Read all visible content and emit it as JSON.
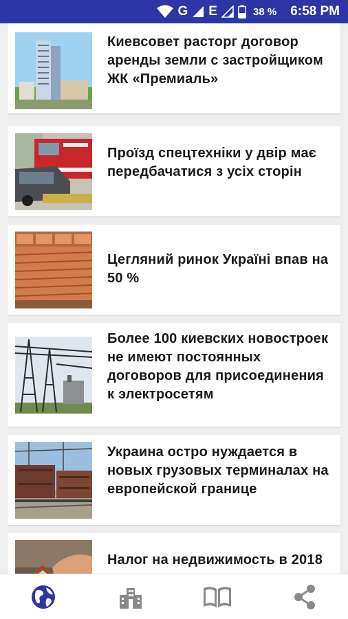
{
  "status_bar": {
    "network_label_1": "G",
    "network_label_2": "E",
    "battery_percent": "38 %",
    "time": "6:58 PM",
    "icons": [
      "wifi-icon",
      "signal-icon",
      "signal-icon",
      "battery-icon"
    ]
  },
  "articles": [
    {
      "title": "Киевсовет расторг договор аренды земли с застройщиком ЖК «Премиаль»",
      "thumb": "high-rise-building"
    },
    {
      "title": "Проїзд спецтехніки у двір має передбачатися з усіх сторін",
      "thumb": "fire-truck"
    },
    {
      "title": "Цегляний ринок Україні впав на 50 %",
      "thumb": "brick-stacks"
    },
    {
      "title": "Более 100 киевских новостроек не имеют постоянных договоров для присоединения к электросетям",
      "thumb": "power-substation"
    },
    {
      "title": "Украина остро нуждается в новых грузовых терминалах на европейской границе",
      "thumb": "freight-train"
    },
    {
      "title": "Налог на недвижимость в 2018",
      "thumb": "house-in-hands"
    }
  ],
  "bottom_nav": {
    "items": [
      {
        "icon": "globe-icon",
        "active": true
      },
      {
        "icon": "city-icon",
        "active": false
      },
      {
        "icon": "book-icon",
        "active": false
      },
      {
        "icon": "share-icon",
        "active": false
      }
    ],
    "colors": {
      "active": "#2c36a6",
      "inactive": "#8a8a8a"
    }
  },
  "colors": {
    "status_bar": "#2c36a6",
    "background": "#eeeeee",
    "card": "#ffffff"
  }
}
